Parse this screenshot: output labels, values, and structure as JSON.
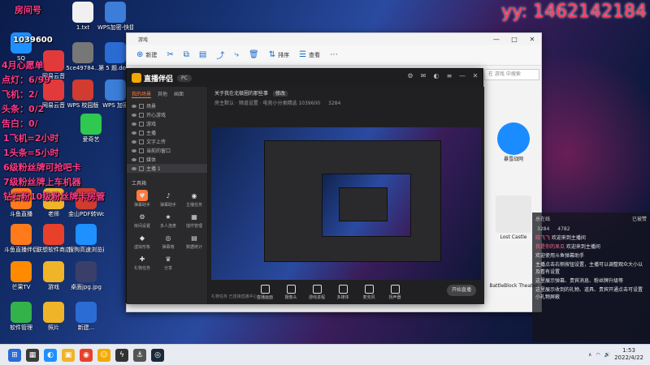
{
  "overlay": {
    "yy": "yy: 1462142184",
    "room_label": "房间号",
    "room_id": "1039600",
    "lines": [
      "4月心愿单",
      "点灯：6/99",
      "飞机：2/",
      "头条：0/2",
      "告白：0/",
      "1飞机=2小时",
      "1头条=5小时",
      "6级粉丝牌可抢吧卡",
      "7级粉丝牌上车机器",
      "钻石粉10级粉丝牌卡房管"
    ]
  },
  "desktop_icons": [
    {
      "label": "SQ",
      "color": "#1e90ff"
    },
    {
      "label": "1.txt",
      "color": "#f0f0f0"
    },
    {
      "label": "WPS加密-快捷方式",
      "color": "#3b7dd8"
    },
    {
      "label": "网易云音",
      "color": "#e23a3a"
    },
    {
      "label": "5ce49784...",
      "color": "#777"
    },
    {
      "label": "第 5 题.docx",
      "color": "#2b6cd4"
    },
    {
      "label": "网易云音",
      "color": "#e23a3a"
    },
    {
      "label": "WPS 校园版",
      "color": "#d23b2f"
    },
    {
      "label": "WPS 加密",
      "color": "#3b7dd8"
    },
    {
      "label": "爱奇艺",
      "color": "#2ec94e"
    },
    {
      "label": "斗鱼直播",
      "color": "#ff7a1a"
    },
    {
      "label": "老师",
      "color": "#f0b429"
    },
    {
      "label": "金山PDF转Word",
      "color": "#d23b2f"
    },
    {
      "label": "斗鱼直播伴侣",
      "color": "#ff7a1a"
    },
    {
      "label": "联想软件商店",
      "color": "#e8402b"
    },
    {
      "label": "搜狗高速浏览器",
      "color": "#1e90ff"
    },
    {
      "label": "芒果TV",
      "color": "#ff8a00"
    },
    {
      "label": "游戏",
      "color": "#f0b429"
    },
    {
      "label": "桌面jpg.jpg",
      "color": "#3a3f6a"
    },
    {
      "label": "软件管理",
      "color": "#33b249"
    },
    {
      "label": "照片",
      "color": "#f0b429"
    },
    {
      "label": "新建...",
      "color": "#2b6cd4"
    }
  ],
  "explorer": {
    "title": "游戏",
    "toolbar": [
      {
        "icon": "⊕",
        "label": "新建"
      },
      {
        "icon": "✂",
        "label": ""
      },
      {
        "icon": "⧉",
        "label": ""
      },
      {
        "icon": "▤",
        "label": ""
      },
      {
        "icon": "⤴",
        "label": ""
      },
      {
        "icon": "⤷",
        "label": ""
      },
      {
        "icon": "🗑",
        "label": ""
      },
      {
        "icon": "⇅",
        "label": "排序"
      },
      {
        "icon": "☰",
        "label": "查看"
      },
      {
        "icon": "⋯",
        "label": ""
      }
    ],
    "search_placeholder": "在 游戏 中搜索",
    "files": [
      {
        "name": "暴雪战网",
        "color": "#1a8cff"
      },
      {
        "name": "Lost Castle",
        "color": "#e8e8e8"
      },
      {
        "name": "BattleBlock Theater",
        "color": "#f2f2f2"
      }
    ]
  },
  "app": {
    "logo": "直播伴侣",
    "pc_pill": "PC",
    "tabs": [
      "我的场景",
      "其他",
      "画面"
    ],
    "scenes": [
      "场景",
      "开心游戏",
      "游戏",
      "主播",
      "文字上传",
      "当前的窗口",
      "媒体",
      "主播 1"
    ],
    "tools_header": "工具箱",
    "tools": [
      {
        "icon": "♥",
        "label": "弹幕助手",
        "color": "#ff7a3c"
      },
      {
        "icon": "♪",
        "label": "弹幕助手"
      },
      {
        "icon": "◉",
        "label": "主播任务"
      },
      {
        "icon": "⚙",
        "label": "房间设置"
      },
      {
        "icon": "★",
        "label": "多人连麦"
      },
      {
        "icon": "▦",
        "label": "插件管理"
      },
      {
        "icon": "◆",
        "label": "虚拟形象"
      },
      {
        "icon": "◎",
        "label": "弹幕墙"
      },
      {
        "icon": "▤",
        "label": "数据统计"
      },
      {
        "icon": "✚",
        "label": "礼物任务"
      },
      {
        "icon": "♛",
        "label": "分享"
      }
    ],
    "room_title": "关于我在北极圈的那些事",
    "edit_label": "修改",
    "subline": "房主默认  ·  频道设置  ·  电竞小分类精选  1039600",
    "viewers": "3284",
    "controls": [
      "直播画面",
      "摄像头",
      "游戏进程",
      "多媒体",
      "麦克风",
      "扬声器"
    ],
    "start_button": "开始直播",
    "status": "礼物任务  已连接直播中心..."
  },
  "chat": {
    "header_left": "总在线",
    "header_right": "已被赞",
    "stats": [
      "3284",
      "4782"
    ],
    "messages": [
      {
        "name": "晓飞飞",
        "text": "欢迎来到主播间"
      },
      {
        "name": "我是你的呆瓜",
        "text": "欢迎来到主播间"
      },
      {
        "name": "",
        "text": "欢迎使用斗鱼弹幕助手"
      },
      {
        "name": "",
        "text": "主播点击右侧按钮设置，主播可以调整观众大小以及看有设置"
      },
      {
        "name": "",
        "text": "这里展示弹幕、贵宾消息、粉丝牌升级等"
      },
      {
        "name": "",
        "text": "这里展示收到的礼物、道具、贵宾开通点击可设置小礼物屏蔽"
      }
    ]
  },
  "taskbar": {
    "apps": [
      {
        "icon": "⊞",
        "color": "#2b6cd4"
      },
      {
        "icon": "▦",
        "color": "#3b3b3b"
      },
      {
        "icon": "◐",
        "color": "#1e90ff"
      },
      {
        "icon": "▣",
        "color": "#f0b429"
      },
      {
        "icon": "◉",
        "color": "#e8402b"
      },
      {
        "icon": "☺",
        "color": "#f2a900"
      },
      {
        "icon": "ϟ",
        "color": "#333"
      },
      {
        "icon": "⚓",
        "color": "#555"
      },
      {
        "icon": "◎",
        "color": "#1b2838"
      }
    ],
    "time": "1:53",
    "date": "2022/4/22"
  }
}
